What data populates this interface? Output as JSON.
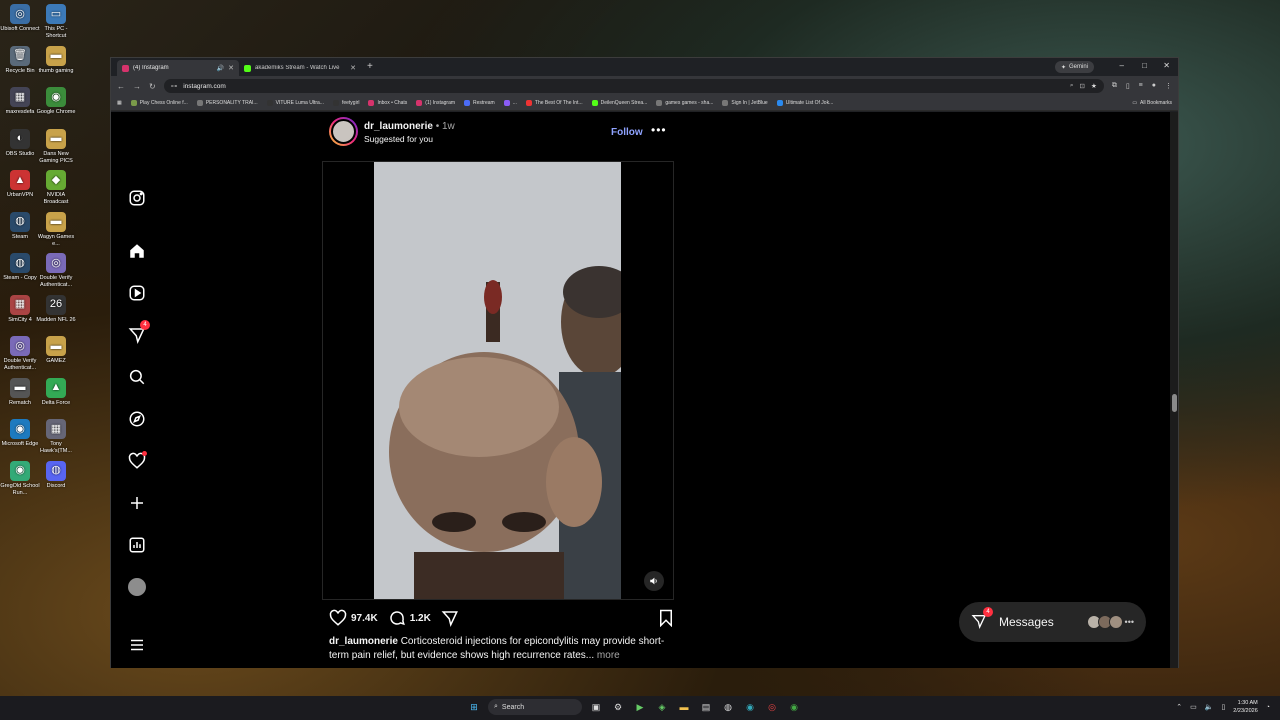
{
  "desktop": {
    "icons": [
      {
        "label": "Ubisoft Connect",
        "glyph": "◎",
        "color": "#3a6ea5"
      },
      {
        "label": "This PC - Shortcut",
        "glyph": "▭",
        "color": "#3c7ab8"
      },
      {
        "label": "Recycle Bin",
        "glyph": "🗑",
        "color": "#5a6a7a"
      },
      {
        "label": "thumb gaming",
        "glyph": "▬",
        "color": "#c8a24a"
      },
      {
        "label": "maxresdefa",
        "glyph": "▦",
        "color": "#445"
      },
      {
        "label": "Google Chrome",
        "glyph": "◉",
        "color": "#3b8c3b"
      },
      {
        "label": "OBS Studio",
        "glyph": "◐",
        "color": "#333"
      },
      {
        "label": "Dans New Gaming PICS",
        "glyph": "▬",
        "color": "#c8a24a"
      },
      {
        "label": "UrbanVPN",
        "glyph": "▲",
        "color": "#c33"
      },
      {
        "label": "NVIDIA Broadcast",
        "glyph": "◆",
        "color": "#6a3"
      },
      {
        "label": "Steam",
        "glyph": "◍",
        "color": "#2a4a6a"
      },
      {
        "label": "Wagyn Games e...",
        "glyph": "▬",
        "color": "#c8a24a"
      },
      {
        "label": "Steam - Copy",
        "glyph": "◍",
        "color": "#2a4a6a"
      },
      {
        "label": "Double Verify Authenticat...",
        "glyph": "◎",
        "color": "#7a6ab8"
      },
      {
        "label": "SimCity 4",
        "glyph": "▦",
        "color": "#a44"
      },
      {
        "label": "Madden NFL 26",
        "glyph": "26",
        "color": "#333"
      },
      {
        "label": "Double Verify Authenticat...",
        "glyph": "◎",
        "color": "#7a6ab8"
      },
      {
        "label": "GAMEZ",
        "glyph": "▬",
        "color": "#c8a24a"
      },
      {
        "label": "Rematch",
        "glyph": "▬",
        "color": "#555"
      },
      {
        "label": "Delta Force",
        "glyph": "▲",
        "color": "#3a5"
      },
      {
        "label": "Microsoft Edge",
        "glyph": "◉",
        "color": "#1d7abf"
      },
      {
        "label": "Tony Hawk's(TM...",
        "glyph": "▦",
        "color": "#667"
      },
      {
        "label": "GregOld School Run...",
        "glyph": "◉",
        "color": "#3a7"
      },
      {
        "label": "Discord",
        "glyph": "◍",
        "color": "#5865f2"
      }
    ]
  },
  "browser": {
    "tabs": [
      {
        "title": "(4) Instagram",
        "active": true,
        "fav_color": "#d6336c",
        "audio_icon": "speaker-icon"
      },
      {
        "title": "akademiks Stream - Watch Live",
        "active": false,
        "fav_color": "#53fc18"
      }
    ],
    "new_tab": "+",
    "gemini_label": "Gemini",
    "controls": {
      "minimize": "–",
      "maximize": "□",
      "close": "✕"
    },
    "url": "instagram.com",
    "bookmarks": [
      {
        "label": "Play Chess Online f...",
        "color": "#7a9a4a"
      },
      {
        "label": "PERSONALITY TRAI...",
        "color": "#777"
      },
      {
        "label": "VITURE Luma Ultra...",
        "color": "#333"
      },
      {
        "label": "feetygirl",
        "color": "#333"
      },
      {
        "label": "Inbox • Chats",
        "color": "#d6336c"
      },
      {
        "label": "(1) Instagram",
        "color": "#d6336c"
      },
      {
        "label": "Restream",
        "color": "#4b6cf7"
      },
      {
        "label": "...",
        "color": "#8a5cf6"
      },
      {
        "label": "The Best Of The Int...",
        "color": "#e33"
      },
      {
        "label": "DeilenQueen Strea...",
        "color": "#53fc18"
      },
      {
        "label": "games games - sha...",
        "color": "#777"
      },
      {
        "label": "Sign In | JetBlue",
        "color": "#777"
      },
      {
        "label": "Ultimate List Of Jok...",
        "color": "#2a8af0"
      }
    ],
    "all_bookmarks": "All Bookmarks"
  },
  "instagram": {
    "nav_badge": "4",
    "post": {
      "username": "dr_laumonerie",
      "separator": "•",
      "time": "1w",
      "suggested": "Suggested for you",
      "follow": "Follow",
      "likes": "97.4K",
      "comments": "1.2K",
      "caption_user": "dr_laumonerie",
      "caption_text": "Corticosteroid injections for epicondylitis may provide short-term pain relief, but evidence shows high recurrence rates...",
      "caption_more": "more"
    },
    "messages": {
      "label": "Messages",
      "badge": "4"
    }
  },
  "taskbar": {
    "search_label": "Search",
    "time": "1:30 AM",
    "date": "2/23/2026"
  }
}
